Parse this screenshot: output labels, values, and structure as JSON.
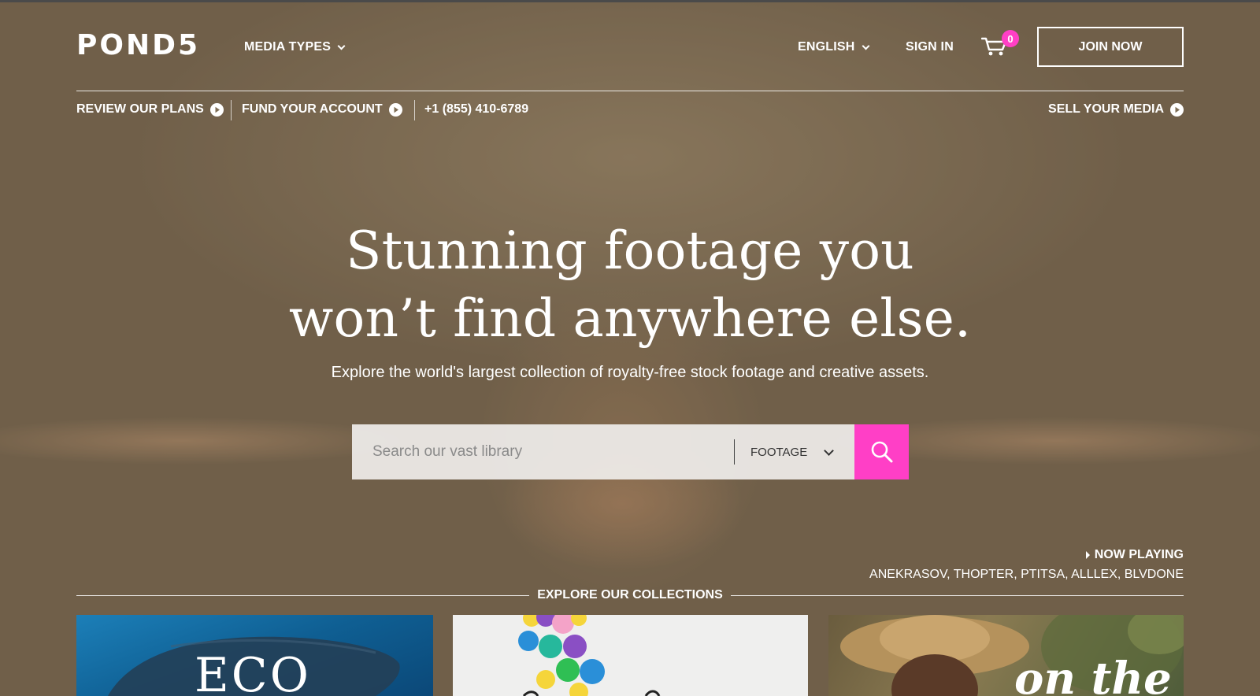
{
  "header": {
    "logo": "POND5",
    "media_types": "MEDIA TYPES",
    "language": "ENGLISH",
    "sign_in": "SIGN IN",
    "cart_count": "0",
    "join_now": "JOIN NOW"
  },
  "subnav": {
    "review_plans": "REVIEW OUR PLANS",
    "fund_account": "FUND YOUR ACCOUNT",
    "phone": "+1 (855) 410-6789",
    "sell_media": "SELL YOUR MEDIA"
  },
  "hero": {
    "headline_line1": "Stunning footage you",
    "headline_line2": "won’t find anywhere else.",
    "subheadline": "Explore the world's largest collection of royalty-free stock footage and creative assets."
  },
  "search": {
    "placeholder": "Search our vast library",
    "media_type": "FOOTAGE"
  },
  "now_playing": {
    "label": "NOW PLAYING",
    "credits": "ANEKRASOV, THOPTER, PTITSA, ALLLEX, BLVDONE"
  },
  "collections": {
    "heading": "EXPLORE OUR COLLECTIONS",
    "cards": [
      {
        "text": "ECO",
        "icon": "whale-image"
      },
      {
        "text": "",
        "icon": "balloons-image"
      },
      {
        "text": "on the",
        "icon": "woman-hat-image"
      }
    ]
  },
  "colors": {
    "accent": "#ff3fc6",
    "text": "#ffffff"
  }
}
